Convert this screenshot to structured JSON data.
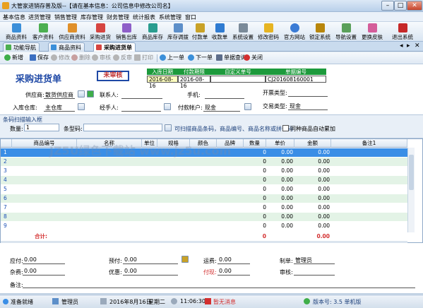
{
  "window": {
    "title": "大管家进销存普及版--【请在基本信息：公司信息中修改公司名】",
    "min": "–",
    "max": "□",
    "close": "✕"
  },
  "menu": [
    "基本信息",
    "进货管理",
    "销售管理",
    "库存管理",
    "财务管理",
    "统计报表",
    "系统管理",
    "窗口"
  ],
  "toolbar": [
    "商品资料",
    "客户资料",
    "供应商资料",
    "采购进货",
    "销售出库",
    "商品库存",
    "库存调拨",
    "付款单",
    "收款单",
    "系统设置",
    "修改密码",
    "官方网站",
    "锁定系统",
    "导航设置",
    "更换皮肤",
    "退出系统"
  ],
  "tabs": [
    "功能导航",
    "商品资料",
    "采购进货单"
  ],
  "actions": {
    "new": "新增",
    "save": "保存",
    "edit": "修改",
    "delete": "删除",
    "audit": "审核",
    "unaudit": "反审",
    "print": "打印",
    "prev": "上一单",
    "next": "下一单",
    "query": "单据查询",
    "close": "关闭"
  },
  "doc": {
    "title": "采购进货单",
    "stamp": "未审核",
    "heads": [
      "入库日期",
      "付款期限",
      "自定义单号",
      "单据编号"
    ],
    "vals": [
      "2016-08-16",
      "2016-08-16",
      "",
      "CJ201608160001"
    ],
    "supplier_label": "供应商:",
    "supplier": "散货供应商",
    "contact_label": "联系人:",
    "phone_label": "手机:",
    "open_type_label": "开票类型:",
    "warehouse_label": "入库仓库:",
    "warehouse": "主仓库",
    "handler_label": "经手人:",
    "account_label": "付款帐户:",
    "account": "现金",
    "trade_type_label": "交易类型:",
    "trade_type": "现金"
  },
  "scan": {
    "title": "条码扫描输入框",
    "qty_label": "数量:",
    "qty": "1",
    "code_label": "条型码:",
    "code": "",
    "hint": "可扫描商品条码，商品编号、商品名称或拼音码",
    "merge": "同种商品自动累加"
  },
  "grid": {
    "headers": [
      "",
      "商品编号",
      "名称",
      "单位",
      "规格",
      "颜色",
      "品牌",
      "数量",
      "单价",
      "金额",
      "备注1"
    ],
    "rows": [
      {
        "n": "1",
        "qty": "0",
        "price": "0.00",
        "amount": "0.00"
      },
      {
        "n": "2",
        "qty": "0",
        "price": "0.00",
        "amount": "0.00"
      },
      {
        "n": "3",
        "qty": "0",
        "price": "0.00",
        "amount": "0.00"
      },
      {
        "n": "4",
        "qty": "0",
        "price": "0.00",
        "amount": "0.00"
      },
      {
        "n": "5",
        "qty": "0",
        "price": "0.00",
        "amount": "0.00"
      },
      {
        "n": "6",
        "qty": "0",
        "price": "0.00",
        "amount": "0.00"
      },
      {
        "n": "7",
        "qty": "0",
        "price": "0.00",
        "amount": "0.00"
      },
      {
        "n": "8",
        "qty": "0",
        "price": "0.00",
        "amount": "0.00"
      },
      {
        "n": "9",
        "qty": "0",
        "price": "0.00",
        "amount": "0.00"
      }
    ],
    "total_label": "合计:",
    "total_qty": "0",
    "total_amount": "0.00"
  },
  "footer": {
    "payable_label": "应付:",
    "payable": "0.00",
    "prepaid_label": "预付:",
    "prepaid": "0.00",
    "freight_label": "运费:",
    "freight": "0.00",
    "maker_label": "制单:",
    "maker": "管理员",
    "misc_label": "杂费:",
    "misc": "0.00",
    "discount_label": "优惠:",
    "discount": "0.00",
    "paid_label": "付现:",
    "paid": "0.00",
    "auditor_label": "审核:",
    "remark_label": "备注:"
  },
  "status": {
    "ready": "准备就绪",
    "user": "管理员",
    "date": "2016年8月16日",
    "weekday": "星期二",
    "time": "11:06:30",
    "msg": "暂无消息",
    "version": "版本号: 3.5 单机版"
  },
  "watermark": "JZ5U绿色下载站 www.jz5u.com"
}
